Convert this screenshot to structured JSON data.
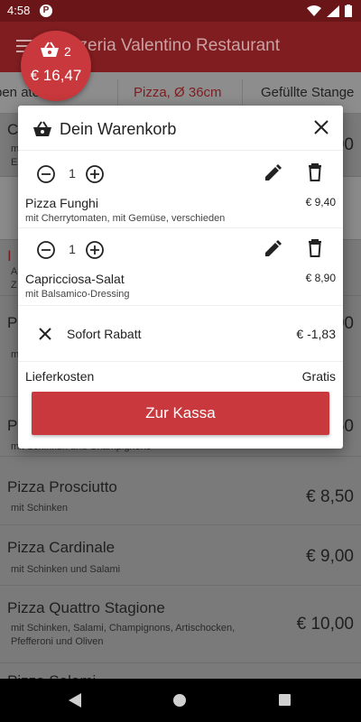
{
  "status": {
    "time": "4:58",
    "app_icon": "P"
  },
  "appbar": {
    "title": "zzeria Valentino Restaurant"
  },
  "tabs": [
    {
      "label": "pen      ate"
    },
    {
      "label": "Pizza, Ø 36cm"
    },
    {
      "label": "Gefüllte Stange"
    }
  ],
  "cart_fab": {
    "count": "2",
    "amount": "€ 16,47"
  },
  "background_list": [
    {
      "name": "C",
      "desc": "m\nE",
      "price": "€ 5,00"
    },
    {
      "name": "I",
      "desc": "A\nZ",
      "price": ""
    },
    {
      "name": "P",
      "desc": "m",
      "price": "€ 7,00"
    },
    {
      "name": "P",
      "desc": "mit Schinken und Champignons",
      "price": "€ 8,50"
    },
    {
      "name": "Pizza Prosciutto",
      "desc": "mit Schinken",
      "price": "€ 8,50"
    },
    {
      "name": "Pizza Cardinale",
      "desc": "mit Schinken und Salami",
      "price": "€ 9,00"
    },
    {
      "name": "Pizza Quattro Stagione",
      "desc": "mit Schinken, Salami, Champignons, Artischocken,\nPfefferoni und Oliven",
      "price": "€ 10,00"
    },
    {
      "name": "Pizza Salami",
      "desc": "",
      "price": ""
    }
  ],
  "dialog": {
    "title": "Dein Warenkorb",
    "items": [
      {
        "qty": "1",
        "name": "Pizza Funghi",
        "desc": "mit Cherrytomaten, mit Gemüse, verschieden",
        "price": "€ 9,40"
      },
      {
        "qty": "1",
        "name": "Capricciosa-Salat",
        "desc": "mit Balsamico-Dressing",
        "price": "€ 8,90"
      }
    ],
    "discount": {
      "label": "Sofort Rabatt",
      "value": "€ -1,83"
    },
    "delivery": {
      "label": "Lieferkosten",
      "value": "Gratis"
    },
    "checkout_label": "Zur Kassa"
  },
  "colors": {
    "accent": "#c8383c",
    "appbar": "#7f1d20",
    "statusbar": "#6a1517"
  }
}
